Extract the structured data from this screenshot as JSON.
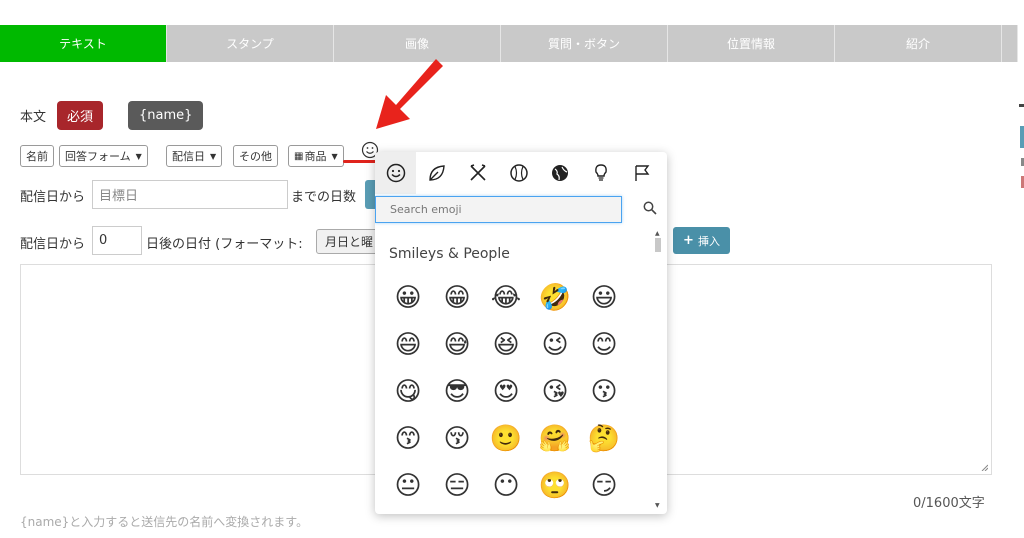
{
  "tabs": [
    "テキスト",
    "スタンプ",
    "画像",
    "質問・ボタン",
    "位置情報",
    "紹介"
  ],
  "body_label": "本文",
  "required_badge": "必須",
  "name_badge": "{name}",
  "toolbar": {
    "name": "名前",
    "answer_form": "回答フォーム",
    "delivery_date": "配信日",
    "other": "その他",
    "product": "商品"
  },
  "row1": {
    "prefix": "配信日から",
    "placeholder": "目標日",
    "suffix": "までの日数"
  },
  "row2": {
    "prefix": "配信日から",
    "value": "0",
    "suffix": "日後の日付 (フォーマット:",
    "format_btn": "月日と曜"
  },
  "insert_label": "挿入",
  "counter": "0/1600文字",
  "note": "{name}と入力すると送信先の名前へ変換されます。",
  "emoji_picker": {
    "search_placeholder": "Search emoji",
    "section_title": "Smileys & People",
    "category_icons": [
      "smiley-category-icon",
      "leaf-category-icon",
      "utensils-category-icon",
      "ball-category-icon",
      "globe-category-icon",
      "lightbulb-category-icon",
      "flag-category-icon"
    ],
    "emojis": [
      "😀",
      "😁",
      "😂",
      "🤣",
      "😃",
      "😄",
      "😅",
      "😆",
      "😉",
      "😊",
      "😋",
      "😎",
      "😍",
      "😘",
      "😗",
      "😙",
      "😚",
      "🙂",
      "🤗",
      "🤔",
      "😐",
      "😑",
      "😶",
      "🙄",
      "😏"
    ]
  },
  "colors": {
    "active_tab": "#00b900",
    "required": "#a8262b",
    "name_badge": "#5a5a5a",
    "insert_button": "#4a90a8",
    "arrow": "#e8231c"
  }
}
